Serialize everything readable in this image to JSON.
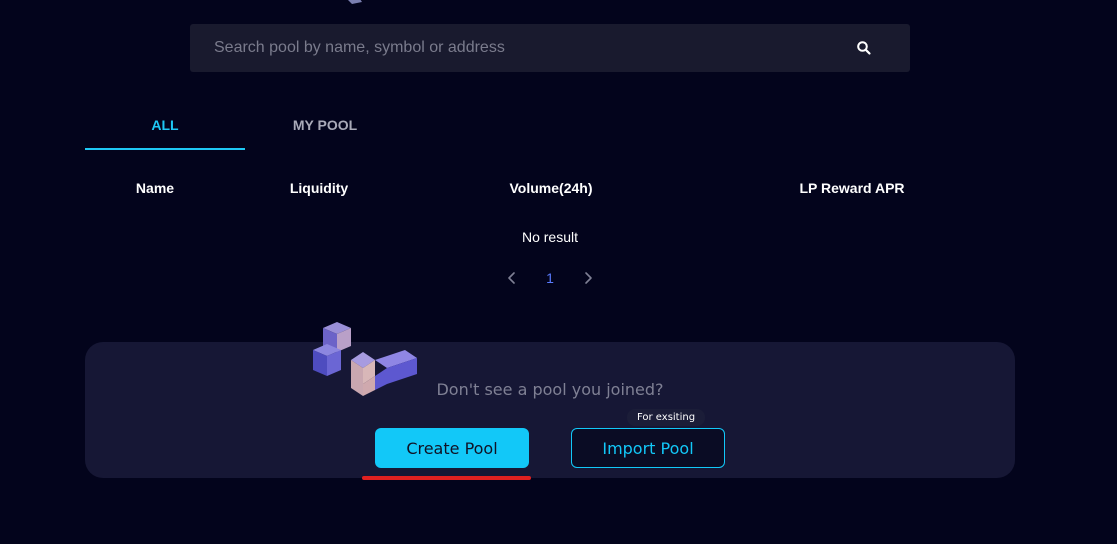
{
  "search": {
    "placeholder": "Search pool by name, symbol or address",
    "icon": "search-icon"
  },
  "tabs": [
    {
      "label": "ALL",
      "active": true
    },
    {
      "label": "MY POOL",
      "active": false
    }
  ],
  "table": {
    "columns": [
      "Name",
      "Liquidity",
      "Volume(24h)",
      "LP Reward APR"
    ],
    "empty_text": "No result"
  },
  "pagination": {
    "current_page": "1",
    "prev_icon": "chevron-left-icon",
    "next_icon": "chevron-right-icon"
  },
  "pool_card": {
    "prompt": "Don't see a pool you joined?",
    "create_label": "Create Pool",
    "import_label": "Import Pool",
    "import_tooltip": "For exsiting"
  },
  "colors": {
    "background": "#03041c",
    "accent": "#12c8f8",
    "card": "#161735",
    "page_active": "#5a7cff",
    "annotation": "#e02020"
  }
}
